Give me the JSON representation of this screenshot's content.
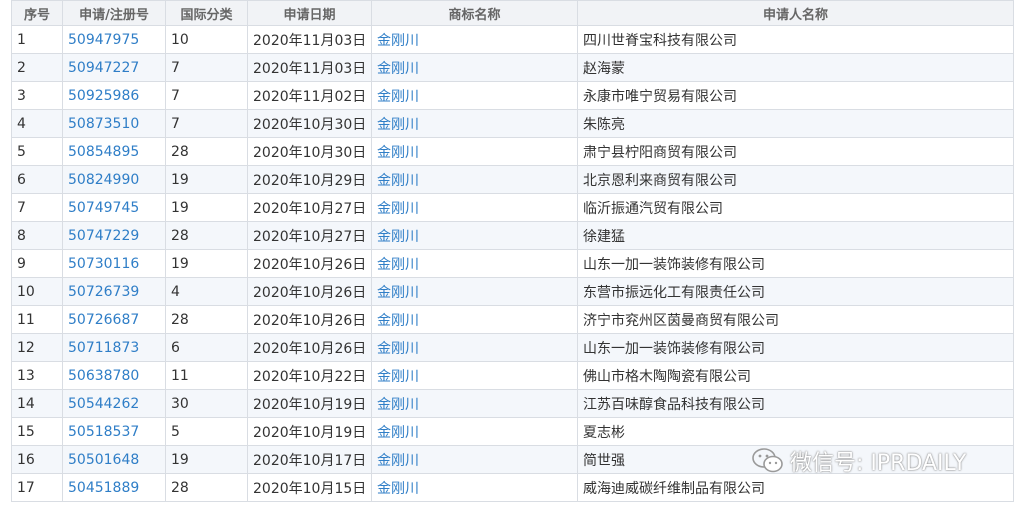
{
  "headers": [
    "序号",
    "申请/注册号",
    "国际分类",
    "申请日期",
    "商标名称",
    "申请人名称"
  ],
  "rows": [
    {
      "no": "1",
      "reg": "50947975",
      "cls": "10",
      "date": "2020年11月03日",
      "mark": "金刚川",
      "applicant": "四川世脊宝科技有限公司"
    },
    {
      "no": "2",
      "reg": "50947227",
      "cls": "7",
      "date": "2020年11月03日",
      "mark": "金刚川",
      "applicant": "赵海蒙"
    },
    {
      "no": "3",
      "reg": "50925986",
      "cls": "7",
      "date": "2020年11月02日",
      "mark": "金刚川",
      "applicant": "永康市唯宁贸易有限公司"
    },
    {
      "no": "4",
      "reg": "50873510",
      "cls": "7",
      "date": "2020年10月30日",
      "mark": "金刚川",
      "applicant": "朱陈亮"
    },
    {
      "no": "5",
      "reg": "50854895",
      "cls": "28",
      "date": "2020年10月30日",
      "mark": "金刚川",
      "applicant": "肃宁县柠阳商贸有限公司"
    },
    {
      "no": "6",
      "reg": "50824990",
      "cls": "19",
      "date": "2020年10月29日",
      "mark": "金刚川",
      "applicant": "北京恩利来商贸有限公司"
    },
    {
      "no": "7",
      "reg": "50749745",
      "cls": "19",
      "date": "2020年10月27日",
      "mark": "金刚川",
      "applicant": "临沂振通汽贸有限公司"
    },
    {
      "no": "8",
      "reg": "50747229",
      "cls": "28",
      "date": "2020年10月27日",
      "mark": "金刚川",
      "applicant": "徐建猛"
    },
    {
      "no": "9",
      "reg": "50730116",
      "cls": "19",
      "date": "2020年10月26日",
      "mark": "金刚川",
      "applicant": "山东一加一装饰装修有限公司"
    },
    {
      "no": "10",
      "reg": "50726739",
      "cls": "4",
      "date": "2020年10月26日",
      "mark": "金刚川",
      "applicant": "东营市振远化工有限责任公司"
    },
    {
      "no": "11",
      "reg": "50726687",
      "cls": "28",
      "date": "2020年10月26日",
      "mark": "金刚川",
      "applicant": "济宁市兖州区茵曼商贸有限公司"
    },
    {
      "no": "12",
      "reg": "50711873",
      "cls": "6",
      "date": "2020年10月26日",
      "mark": "金刚川",
      "applicant": "山东一加一装饰装修有限公司"
    },
    {
      "no": "13",
      "reg": "50638780",
      "cls": "11",
      "date": "2020年10月22日",
      "mark": "金刚川",
      "applicant": "佛山市格木陶陶瓷有限公司"
    },
    {
      "no": "14",
      "reg": "50544262",
      "cls": "30",
      "date": "2020年10月19日",
      "mark": "金刚川",
      "applicant": "江苏百味醇食品科技有限公司"
    },
    {
      "no": "15",
      "reg": "50518537",
      "cls": "5",
      "date": "2020年10月19日",
      "mark": "金刚川",
      "applicant": "夏志彬"
    },
    {
      "no": "16",
      "reg": "50501648",
      "cls": "19",
      "date": "2020年10月17日",
      "mark": "金刚川",
      "applicant": "简世强"
    },
    {
      "no": "17",
      "reg": "50451889",
      "cls": "28",
      "date": "2020年10月15日",
      "mark": "金刚川",
      "applicant": "威海迪威碳纤维制品有限公司"
    }
  ],
  "watermark": "微信号: IPRDAILY",
  "colors": {
    "link": "#2f7ec7",
    "header_bg": "#f1f3f6",
    "row_alt_bg": "#f4f7fb",
    "border": "#d9dde3"
  }
}
